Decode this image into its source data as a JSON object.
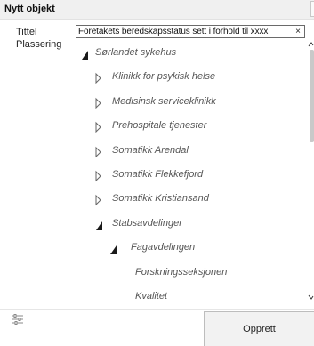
{
  "window": {
    "title": "Nytt objekt"
  },
  "form": {
    "title_label": "Tittel",
    "title_value": "Foretakets beredskapsstatus sett i forhold til xxxx",
    "clear_glyph": "×",
    "placement_label": "Plassering"
  },
  "tree": {
    "nodes": [
      {
        "label": "Sørlandet sykehus",
        "level": 0,
        "expanded": true
      },
      {
        "label": "Klinikk for psykisk helse",
        "level": 1,
        "expanded": false
      },
      {
        "label": "Medisinsk serviceklinikk",
        "level": 1,
        "expanded": false
      },
      {
        "label": "Prehospitale tjenester",
        "level": 1,
        "expanded": false
      },
      {
        "label": "Somatikk Arendal",
        "level": 1,
        "expanded": false
      },
      {
        "label": "Somatikk Flekkefjord",
        "level": 1,
        "expanded": false
      },
      {
        "label": "Somatikk Kristiansand",
        "level": 1,
        "expanded": false
      },
      {
        "label": "Stabsavdelinger",
        "level": 1,
        "expanded": true
      },
      {
        "label": "Fagavdelingen",
        "level": 2,
        "expanded": true
      },
      {
        "label": "Forskningsseksjonen",
        "level": 3,
        "leaf": true
      },
      {
        "label": "Kvalitet",
        "level": 3,
        "leaf": true
      }
    ]
  },
  "footer": {
    "filter_icon": "sliders-icon",
    "create_label": "Opprett"
  },
  "colors": {
    "tree_text": "#555555",
    "arrow_fill": "#1a1a1a",
    "button_bg": "#f2f2f2"
  }
}
